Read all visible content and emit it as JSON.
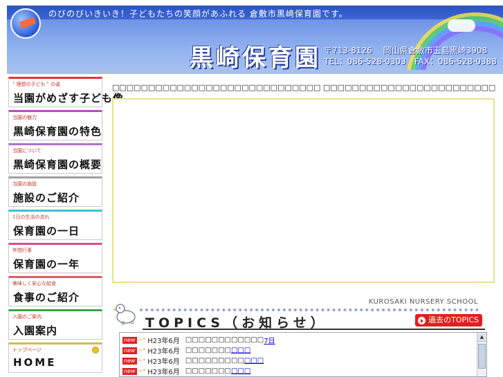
{
  "header": {
    "tagline": "のびのびいきいき！子どもたちの笑顔があふれる 倉敷市黒崎保育園です。",
    "title": "黒崎保育園",
    "address_line1": "〒713-8126　 岡山県倉敷市玉島黒崎3908",
    "address_line2": "TEL：086-528-0303　FAX：086-528-0388"
  },
  "sidebar": {
    "items": [
      {
        "sub": "\" 理想の子ども \" の姿",
        "main": "当園がめざす子ども像",
        "color": "#d83a3a"
      },
      {
        "sub": "当園の魅力",
        "main": "黒崎保育園の特色",
        "color": "#c04ac0"
      },
      {
        "sub": "当園について",
        "main": "黒崎保育園の概要",
        "color": "#b070d0"
      },
      {
        "sub": "当園の施設",
        "main": "施設のご紹介",
        "color": "#a0a0a0"
      },
      {
        "sub": "1日の生活の流れ",
        "main": "保育園の一日",
        "color": "#40c0d0"
      },
      {
        "sub": "年間行事",
        "main": "保育園の一年",
        "color": "#e04a8a"
      },
      {
        "sub": "美味しく安心な給食",
        "main": "食事のご紹介",
        "color": "#e05a6a"
      },
      {
        "sub": "入園のご案内",
        "main": "入園案内",
        "color": "#40a050"
      },
      {
        "sub": "トップページ",
        "main": "HOME",
        "color": "#d0c040"
      }
    ]
  },
  "main": {
    "intro": "□□□□□□□□□□□□□□□□□□□□□□□□□□□□□ □□□□□□□□□□□□□□□□□□□□□□□□□□□□",
    "topics": {
      "english": "KUROSAKI NURSERY SCHOOL",
      "title": "TOPICS（お知らせ）",
      "past_button": "過去のTOPICS",
      "new_label": "new",
      "rows": [
        {
          "date": "H23年6月",
          "text": "□□□□□□□□□□□□",
          "link": "7日"
        },
        {
          "date": "H23年6月",
          "text": "□□□□□□□",
          "link": "□□□"
        },
        {
          "date": "H23年6月",
          "text": "□□□□□□□□□",
          "link": "□□□"
        },
        {
          "date": "H23年6月",
          "text": "□□□□□□□",
          "link": "□□□"
        }
      ]
    }
  },
  "colors": {
    "header_blue": "#3b63d2",
    "content_border": "#ece08a",
    "new_badge": "#e02020",
    "past_button": "#e02020"
  }
}
